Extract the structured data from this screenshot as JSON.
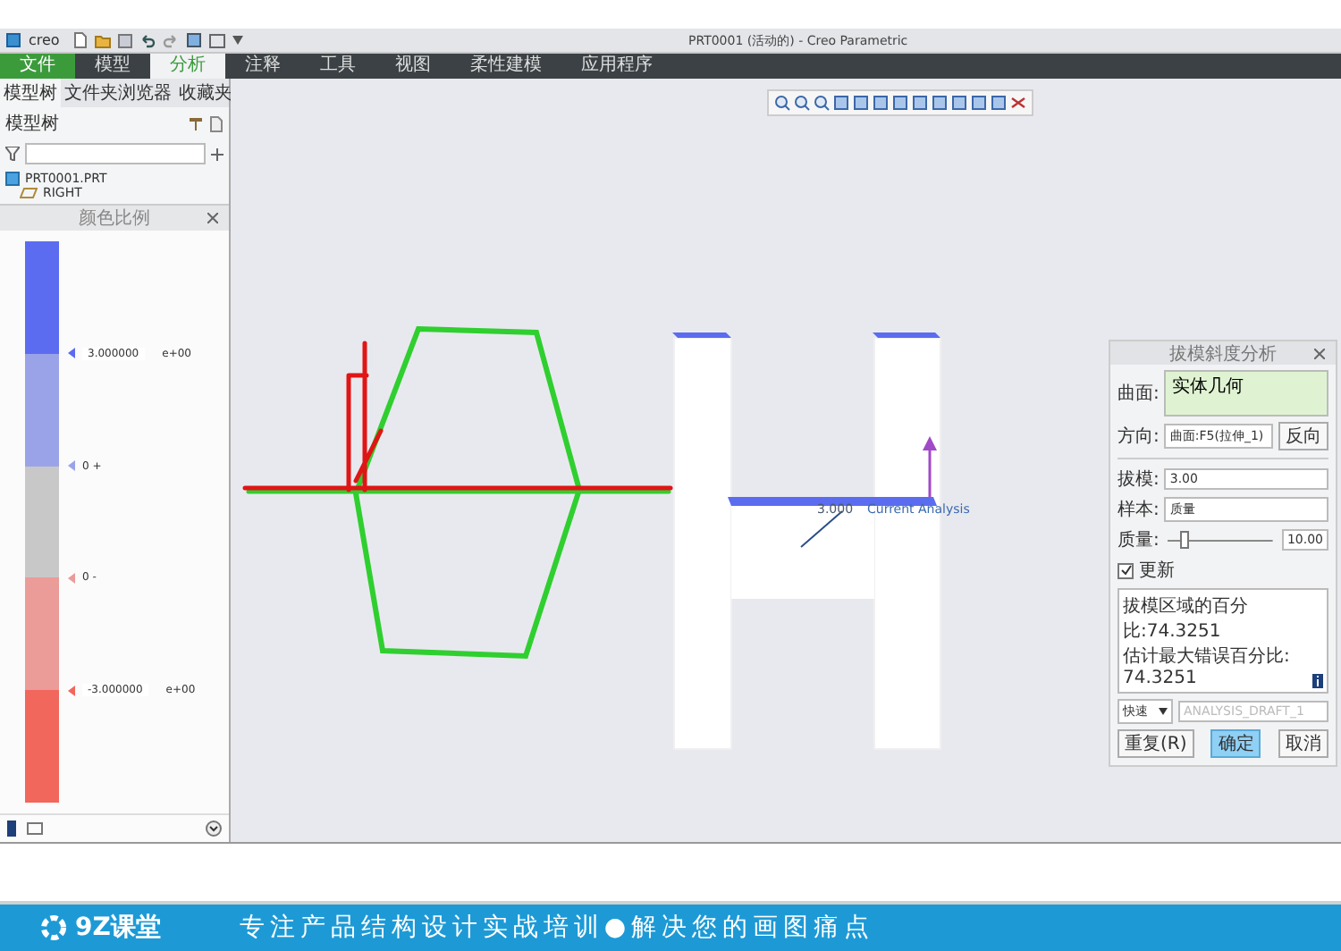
{
  "window": {
    "logo": "creo",
    "title": "PRT0001 (活动的) - Creo Parametric"
  },
  "ribbon_tabs": [
    {
      "label": "文件",
      "kind": "file",
      "selected": false
    },
    {
      "label": "模型",
      "kind": "tab",
      "selected": false
    },
    {
      "label": "分析",
      "kind": "tab",
      "selected": true
    },
    {
      "label": "注释",
      "kind": "tab",
      "selected": false
    },
    {
      "label": "工具",
      "kind": "tab",
      "selected": false
    },
    {
      "label": "视图",
      "kind": "tab",
      "selected": false
    },
    {
      "label": "柔性建模",
      "kind": "tab",
      "selected": false
    },
    {
      "label": "应用程序",
      "kind": "tab",
      "selected": false
    }
  ],
  "navigator": {
    "tabs": [
      {
        "label": "模型树",
        "selected": true
      },
      {
        "label": "文件夹浏览器",
        "selected": false
      },
      {
        "label": "收藏夹",
        "selected": false
      }
    ],
    "heading": "模型树",
    "tree": [
      {
        "label": "PRT0001.PRT",
        "children": [
          {
            "label": "RIGHT"
          }
        ]
      }
    ]
  },
  "color_scale": {
    "title": "颜色比例",
    "bands": [
      {
        "color": "#5b6cf0"
      },
      {
        "color": "#9ba3e8"
      },
      {
        "color": "#c8c8c8"
      },
      {
        "color": "#eb9b98"
      },
      {
        "color": "#f2675c"
      }
    ],
    "labels": [
      {
        "kind": "field",
        "value": "3.000000",
        "exponent": "e+00",
        "color": "#5b6cf0"
      },
      {
        "kind": "plain",
        "value": "0 +",
        "color": "#9ba3e8"
      },
      {
        "kind": "plain",
        "value": "0 -",
        "color": "#eb9b98"
      },
      {
        "kind": "field",
        "value": "-3.000000",
        "exponent": "e+00",
        "color": "#f2675c"
      }
    ]
  },
  "canvas": {
    "annotation_value": "3.000",
    "annotation_label": "Current Analysis"
  },
  "dialog": {
    "title": "拔模斜度分析",
    "surface_label": "曲面:",
    "surface_value": "实体几何",
    "direction_label": "方向:",
    "direction_value": "曲面:F5(拉伸_1)",
    "reverse_button": "反向",
    "draft_label": "拔模:",
    "draft_value": "3.00",
    "sample_label": "样本:",
    "sample_value": "质量",
    "quality_label": "质量:",
    "quality_slider": {
      "level": 0.12
    },
    "quality_value": "10.00",
    "update": {
      "label": "更新",
      "checked": true
    },
    "results": [
      "拔模区域的百分比:74.3251",
      "估计最大错误百分比: 74.3251"
    ],
    "save_mode": "快速",
    "analysis_name": {
      "value": "ANALYSIS_DRAFT_1",
      "disabled": true
    },
    "buttons": [
      {
        "label": "重复(R)",
        "kind": "normal"
      },
      {
        "label": "确定",
        "kind": "primary"
      },
      {
        "label": "取消",
        "kind": "normal"
      }
    ]
  },
  "banner": {
    "logo": "9Z课堂",
    "slogan": "专注产品结构设计实战培训●解决您的画图痛点"
  }
}
